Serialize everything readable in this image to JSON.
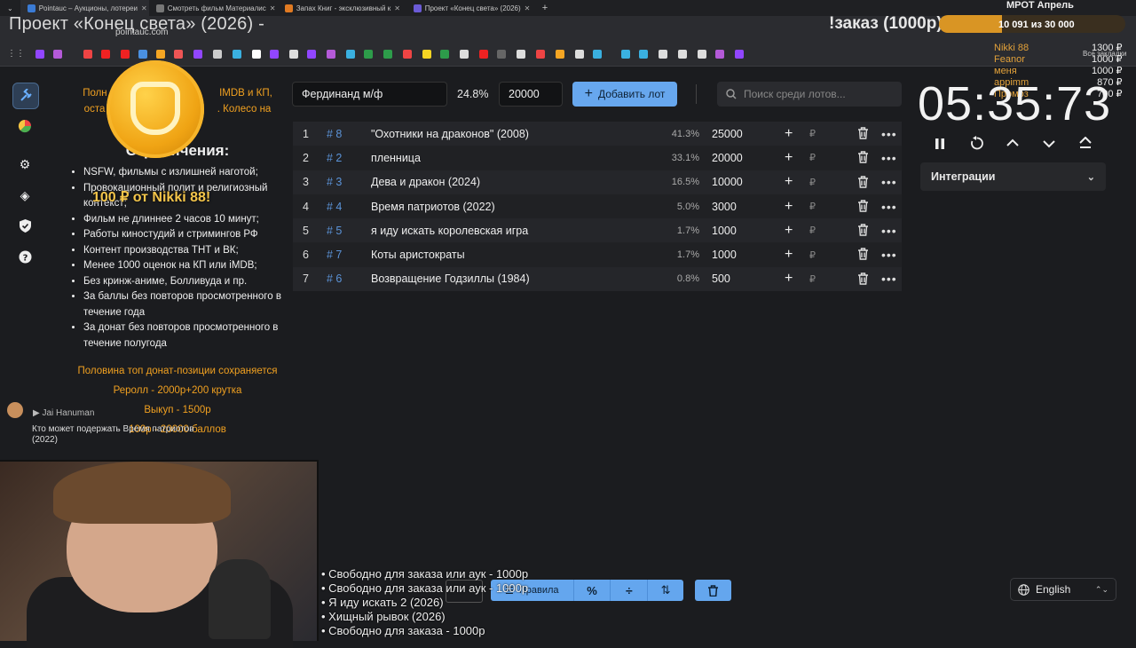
{
  "browser": {
    "tabs": [
      {
        "label": "Pointauc – Аукционы, лотереи",
        "active": true,
        "color": "#3a7bd5"
      },
      {
        "label": "Смотреть фильм Материалис",
        "active": false,
        "color": "#777777"
      },
      {
        "label": "Запах Книг - эксклюзивный к",
        "active": false,
        "color": "#e07a22"
      },
      {
        "label": "Проект «Конец света» (2026)",
        "active": false,
        "color": "#6b5bd6"
      }
    ],
    "url": "pointauc.com",
    "bookmarks_right": "Все закладки"
  },
  "stream_overlay": {
    "title": "Проект «Конец света» (2026) -",
    "order_title": "!заказ (1000р)",
    "goal": {
      "label": "МРОТ Апрель",
      "text": "10 091  из 30 000",
      "fraction": 0.336
    },
    "donors": [
      "Nikki 88",
      "Feanor",
      "меня",
      "appimm",
      "Промоз"
    ],
    "donor_amounts": [
      "1300 ₽",
      "1000 ₽",
      "1000 ₽",
      "870 ₽",
      "700 ₽"
    ],
    "donate_alert": "100 ₽ от Nikki 88!",
    "queue": [
      "• Свободно для заказа или аук - 1000р",
      "• Свободно для заказа или аук - 1000р",
      "• Я иду искать 2 (2026)",
      "• Хищный рывок (2026)",
      "• Свободно для заказа - 1000р"
    ]
  },
  "rules": {
    "intro_part1": "Полн",
    "intro_part2": "IMDB и КП,",
    "intro_line2a": "оста",
    "intro_line2b": ". Колесо на",
    "heading": "Ограничения:",
    "items": [
      "NSFW, фильмы с излишней наготой;",
      "Провокационный полит и религиозный контекст;",
      "Фильм не длиннее 2 часов 10 минут;",
      "Работы киностудий и стримингов РФ",
      "Контент производства ТНТ и ВК;",
      "Менее 1000 оценок на КП или iMDB;",
      "Без кринж-аниме, Болливуда и пр.",
      "За баллы без повторов просмотренного в течение года",
      "За донат без повторов просмотренного в течение полугода"
    ],
    "footer": [
      "Половина топ донат-позиции сохраняется",
      "Реролл - 2000р+200 крутка",
      "Выкуп - 1500р",
      "100р - 20000 баллов"
    ]
  },
  "new_lot": {
    "name": "Фердинанд м/ф",
    "percent": "24.8%",
    "amount": "20000",
    "add_label": "Добавить лот",
    "search_placeholder": "Поиск среди лотов..."
  },
  "lots": [
    {
      "idx": "1",
      "num": "# 8",
      "name": "\"Охотники на драконов\" (2008)",
      "pct": "41.3%",
      "amount": "25000"
    },
    {
      "idx": "2",
      "num": "# 2",
      "name": "пленница",
      "pct": "33.1%",
      "amount": "20000"
    },
    {
      "idx": "3",
      "num": "# 3",
      "name": "Дева и дракон (2024)",
      "pct": "16.5%",
      "amount": "10000"
    },
    {
      "idx": "4",
      "num": "# 4",
      "name": "Время патриотов (2022)",
      "pct": "5.0%",
      "amount": "3000"
    },
    {
      "idx": "5",
      "num": "# 5",
      "name": "я иду искать королевская игра",
      "pct": "1.7%",
      "amount": "1000"
    },
    {
      "idx": "6",
      "num": "# 7",
      "name": "Коты аристократы",
      "pct": "1.7%",
      "amount": "1000"
    },
    {
      "idx": "7",
      "num": "# 6",
      "name": "Возвращение Годзиллы (1984)",
      "pct": "0.8%",
      "amount": "500"
    }
  ],
  "currency": "₽",
  "timer": {
    "value": "05:35:73"
  },
  "integrations": {
    "label": "Интеграции"
  },
  "chat": {
    "user": "Jai Hanuman",
    "message": "Кто может подержать Время патриотов (2022)"
  },
  "toolbar": {
    "rules_label": "Правила",
    "percent_symbol": "%"
  },
  "language": {
    "label": "English"
  },
  "colors": {
    "accent": "#64a6ee",
    "orange": "#f0a020",
    "lot_number": "#5b93d8"
  }
}
